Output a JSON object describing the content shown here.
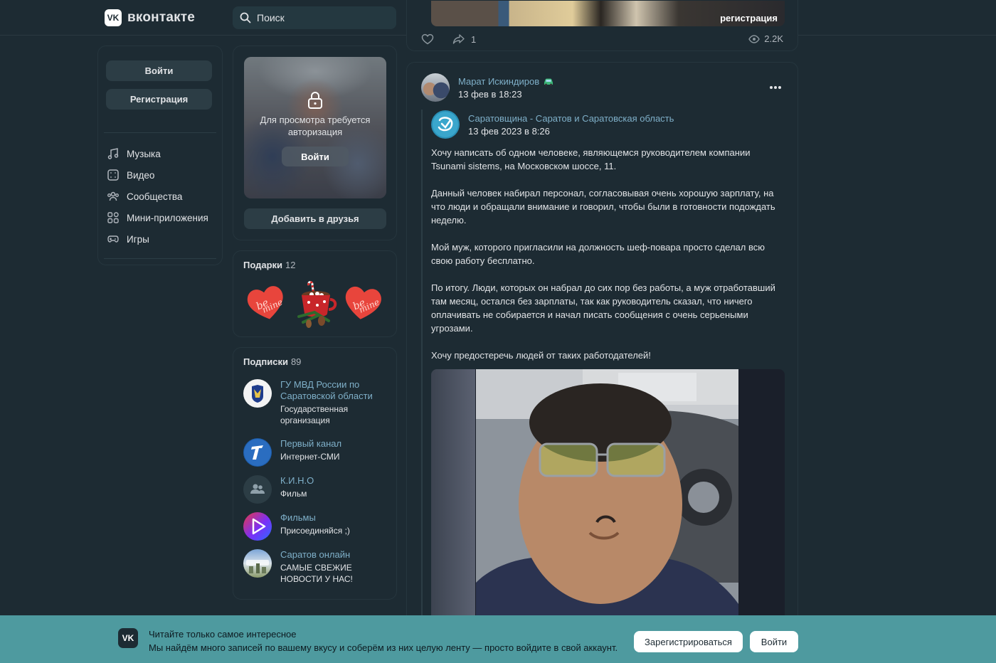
{
  "header": {
    "logo_text": "вконтакте",
    "logo_mark": "VK",
    "search_placeholder": "Поиск"
  },
  "left_menu": {
    "login_label": "Войти",
    "register_label": "Регистрация",
    "items": [
      {
        "label": "Музыка",
        "icon": "music-icon"
      },
      {
        "label": "Видео",
        "icon": "video-icon"
      },
      {
        "label": "Сообщества",
        "icon": "communities-icon"
      },
      {
        "label": "Мини-приложения",
        "icon": "apps-icon"
      },
      {
        "label": "Игры",
        "icon": "games-icon"
      }
    ]
  },
  "profile": {
    "auth_required_text": "Для просмотра требуется авторизация",
    "photo_login_label": "Войти",
    "add_friend_label": "Добавить в друзья"
  },
  "gifts": {
    "title": "Подарки",
    "count": "12"
  },
  "subscriptions": {
    "title": "Подписки",
    "count": "89",
    "items": [
      {
        "name": "ГУ МВД России по Саратовской области",
        "desc": "Государственная организация"
      },
      {
        "name": "Первый канал",
        "desc": "Интернет-СМИ"
      },
      {
        "name": "К.И.Н.О",
        "desc": "Фильм"
      },
      {
        "name": "Фильмы",
        "desc": "Присоединяйся ;)"
      },
      {
        "name": "Саратов онлайн",
        "desc": "САМЫЕ СВЕЖИЕ НОВОСТИ У НАС!"
      }
    ]
  },
  "prev_post": {
    "image_caption": "регистрация",
    "shares": "1",
    "views": "2.2K"
  },
  "post": {
    "author": "Марат Искиндиров",
    "date": "13 фев в 18:23",
    "repost_source": "Саратовщина - Саратов и Саратовская область",
    "repost_date": "13 фев 2023 в 8:26",
    "paragraphs": [
      "Хочу написать об одном человеке, являющемся руководителем компании Tsunami sistems, на Московском шоссе, 11.",
      "Данный человек набирал персонал, согласовывая очень хорошую зарплату, на что люди и обращали внимание и говорил, чтобы были в готовности подождать неделю.",
      "Мой муж, которого пригласили на должность шеф-повара просто сделал всю свою работу бесплатно.",
      "По итогу. Люди, которых он набрал до сих пор без работы, а муж отработавший там месяц, остался без зарплаты, так как руководитель сказал, что ничего оплачивать не собирается и начал писать сообщения с очень серьеными угрозами.",
      "Хочу предостеречь людей от таких работодателей!"
    ]
  },
  "banner": {
    "title": "Читайте только самое интересное",
    "subtitle": "Мы найдём много записей по вашему вкусу и соберём из них целую ленту — просто войдите в свой аккаунт.",
    "register_label": "Зарегистрироваться",
    "login_label": "Войти"
  }
}
